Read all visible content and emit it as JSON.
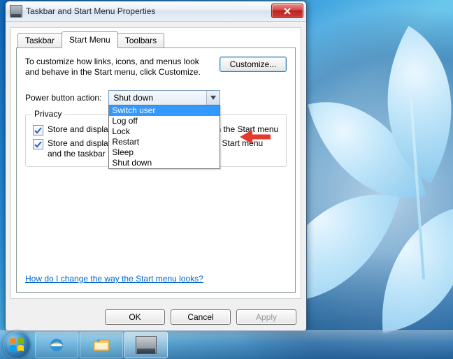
{
  "window": {
    "title": "Taskbar and Start Menu Properties"
  },
  "tabs": {
    "items": [
      "Taskbar",
      "Start Menu",
      "Toolbars"
    ],
    "active_index": 1
  },
  "start_menu_tab": {
    "description": "To customize how links, icons, and menus look and behave in the Start menu, click Customize.",
    "customize_button": "Customize...",
    "power_label": "Power button action:",
    "power_combobox_value": "Shut down",
    "power_options": [
      "Switch user",
      "Log off",
      "Lock",
      "Restart",
      "Sleep",
      "Shut down"
    ],
    "power_selected_option_index": 0,
    "privacy": {
      "legend": "Privacy",
      "check1": {
        "checked": true,
        "label": "Store and display recently opened programs in the Start menu"
      },
      "check2": {
        "checked": true,
        "label": "Store and display recently opened items in the Start menu and the taskbar"
      }
    },
    "help_link": "How do I change the way the Start menu looks?"
  },
  "buttons": {
    "ok": "OK",
    "cancel": "Cancel",
    "apply": "Apply"
  },
  "annotation": {
    "arrow_color": "#e5392e"
  },
  "taskbar": {
    "items": [
      {
        "name": "start-orb",
        "type": "start"
      },
      {
        "name": "ie",
        "type": "ie"
      },
      {
        "name": "explorer",
        "type": "explorer"
      },
      {
        "name": "properties-dialog",
        "type": "window-active"
      }
    ]
  }
}
